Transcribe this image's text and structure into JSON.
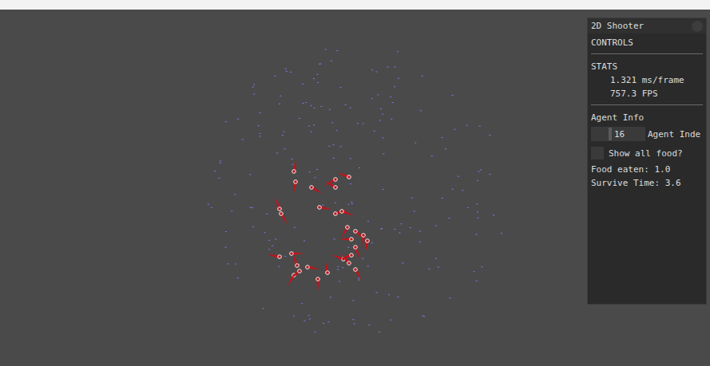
{
  "panel": {
    "title": "2D Shooter",
    "controls": "CONTROLS",
    "stats": {
      "heading": "STATS",
      "lines": [
        "1.321 ms/frame",
        "757.3 FPS"
      ]
    },
    "agent_info": {
      "heading": "Agent Info",
      "index_field": {
        "value": "16",
        "label": "Agent Inde"
      },
      "checkbox": {
        "label": "Show all food?",
        "checked": false
      },
      "lines": [
        "Food eaten: 1.0",
        "Survive Time: 3.6"
      ]
    }
  }
}
